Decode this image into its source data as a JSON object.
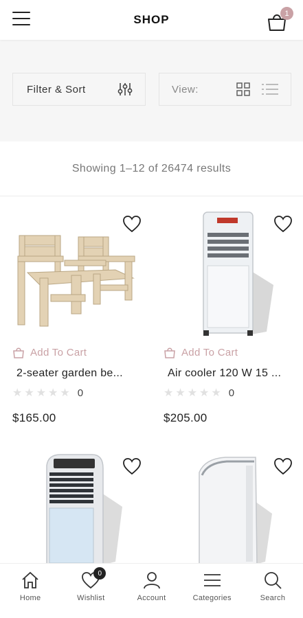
{
  "header": {
    "title": "SHOP",
    "cart_count": "1"
  },
  "toolbar": {
    "filter_label": "Filter & Sort",
    "view_label": "View:"
  },
  "results_text": "Showing 1–12 of 26474 results",
  "products": [
    {
      "name": "2-seater garden be...",
      "add_to_cart": "Add To Cart",
      "rating_count": "0",
      "price": "$165.00"
    },
    {
      "name": "Air cooler 120 W 15 ...",
      "add_to_cart": "Add To Cart",
      "rating_count": "0",
      "price": "$205.00"
    },
    {
      "name": "",
      "add_to_cart": "",
      "rating_count": "",
      "price": ""
    },
    {
      "name": "",
      "add_to_cart": "",
      "rating_count": "",
      "price": ""
    }
  ],
  "bottom_nav": [
    {
      "label": "Home",
      "icon": "home-icon"
    },
    {
      "label": "Wishlist",
      "icon": "heart-icon",
      "badge": "0"
    },
    {
      "label": "Account",
      "icon": "user-icon"
    },
    {
      "label": "Categories",
      "icon": "menu-icon"
    },
    {
      "label": "Search",
      "icon": "search-icon"
    }
  ],
  "colors": {
    "accent": "#c9a1a5",
    "strip_bg": "#f6f6f6"
  }
}
